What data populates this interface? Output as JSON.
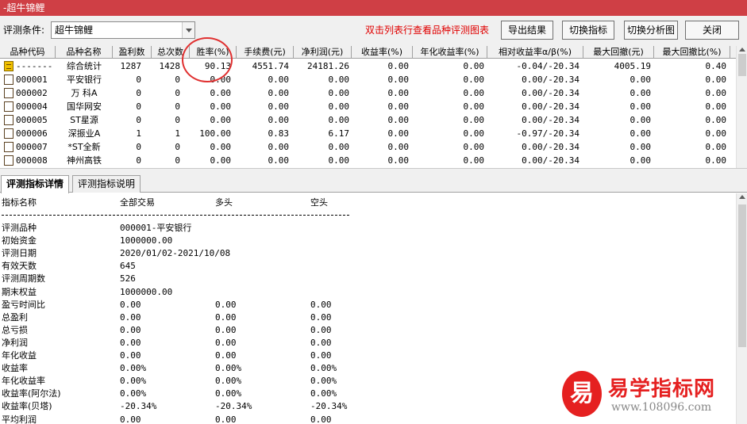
{
  "window": {
    "title": "-超牛锦鲤"
  },
  "toolbar": {
    "condition_label": "评测条件:",
    "condition_value": "超牛锦鲤",
    "hint": "双击列表行查看品种评测图表",
    "export_label": "导出结果",
    "switch_label": "切换指标",
    "chart_label": "切换分析图",
    "close_label": "关闭"
  },
  "grid": {
    "headers": [
      "品种代码",
      "品种名称",
      "盈利数",
      "总次数",
      "胜率(%)",
      "手续费(元)",
      "净利润(元)",
      "收益率(%)",
      "年化收益率(%)",
      "相对收益率α/β(%)",
      "最大回撤(元)",
      "最大回撤比(%)"
    ],
    "rows": [
      {
        "code": "-------",
        "name": "综合统计",
        "win": "1287",
        "total": "1428",
        "rate": "90.13",
        "fee": "4551.74",
        "profit": "24181.26",
        "ret": "0.00",
        "annual": "0.00",
        "rel": "-0.04/-20.34",
        "dd": "4005.19",
        "ddr": "0.40"
      },
      {
        "code": "000001",
        "name": "平安银行",
        "win": "0",
        "total": "0",
        "rate": "0.00",
        "fee": "0.00",
        "profit": "0.00",
        "ret": "0.00",
        "annual": "0.00",
        "rel": "0.00/-20.34",
        "dd": "0.00",
        "ddr": "0.00"
      },
      {
        "code": "000002",
        "name": "万 科A",
        "win": "0",
        "total": "0",
        "rate": "0.00",
        "fee": "0.00",
        "profit": "0.00",
        "ret": "0.00",
        "annual": "0.00",
        "rel": "0.00/-20.34",
        "dd": "0.00",
        "ddr": "0.00"
      },
      {
        "code": "000004",
        "name": "国华网安",
        "win": "0",
        "total": "0",
        "rate": "0.00",
        "fee": "0.00",
        "profit": "0.00",
        "ret": "0.00",
        "annual": "0.00",
        "rel": "0.00/-20.34",
        "dd": "0.00",
        "ddr": "0.00"
      },
      {
        "code": "000005",
        "name": "ST星源",
        "win": "0",
        "total": "0",
        "rate": "0.00",
        "fee": "0.00",
        "profit": "0.00",
        "ret": "0.00",
        "annual": "0.00",
        "rel": "0.00/-20.34",
        "dd": "0.00",
        "ddr": "0.00"
      },
      {
        "code": "000006",
        "name": "深振业A",
        "win": "1",
        "total": "1",
        "rate": "100.00",
        "fee": "0.83",
        "profit": "6.17",
        "ret": "0.00",
        "annual": "0.00",
        "rel": "-0.97/-20.34",
        "dd": "0.00",
        "ddr": "0.00"
      },
      {
        "code": "000007",
        "name": "*ST全新",
        "win": "0",
        "total": "0",
        "rate": "0.00",
        "fee": "0.00",
        "profit": "0.00",
        "ret": "0.00",
        "annual": "0.00",
        "rel": "0.00/-20.34",
        "dd": "0.00",
        "ddr": "0.00"
      },
      {
        "code": "000008",
        "name": "神州高铁",
        "win": "0",
        "total": "0",
        "rate": "0.00",
        "fee": "0.00",
        "profit": "0.00",
        "ret": "0.00",
        "annual": "0.00",
        "rel": "0.00/-20.34",
        "dd": "0.00",
        "ddr": "0.00"
      }
    ]
  },
  "tabs": {
    "detail": "评测指标详情",
    "explain": "评测指标说明"
  },
  "detail": {
    "headers": [
      "指标名称",
      "全部交易",
      "多头",
      "空头"
    ],
    "info": [
      {
        "label": "评测品种",
        "value": "000001-平安银行"
      },
      {
        "label": "初始资金",
        "value": "1000000.00"
      },
      {
        "label": "评测日期",
        "value": "2020/01/02-2021/10/08"
      },
      {
        "label": "有效天数",
        "value": "645"
      },
      {
        "label": "评测周期数",
        "value": "526"
      },
      {
        "label": "期末权益",
        "value": "1000000.00"
      }
    ],
    "metrics": [
      {
        "label": "盈亏时间比",
        "all": "0.00",
        "long": "0.00",
        "short": "0.00"
      },
      {
        "label": "总盈利",
        "all": "0.00",
        "long": "0.00",
        "short": "0.00"
      },
      {
        "label": "总亏损",
        "all": "0.00",
        "long": "0.00",
        "short": "0.00"
      },
      {
        "label": "净利润",
        "all": "0.00",
        "long": "0.00",
        "short": "0.00"
      },
      {
        "label": "年化收益",
        "all": "0.00",
        "long": "0.00",
        "short": "0.00"
      },
      {
        "label": "收益率",
        "all": "0.00%",
        "long": "0.00%",
        "short": "0.00%"
      },
      {
        "label": "年化收益率",
        "all": "0.00%",
        "long": "0.00%",
        "short": "0.00%"
      },
      {
        "label": "收益率(阿尔法)",
        "all": "0.00%",
        "long": "0.00%",
        "short": "0.00%"
      },
      {
        "label": "收益率(贝塔)",
        "all": "-20.34%",
        "long": "-20.34%",
        "short": "-20.34%"
      },
      {
        "label": "平均利润",
        "all": "0.00",
        "long": "0.00",
        "short": "0.00"
      }
    ]
  },
  "watermark": {
    "logo_char": "易",
    "brand": "易学指标网",
    "url": "www.108096.com"
  },
  "colors": {
    "titlebar": "#cf3f45",
    "hint": "#e00000",
    "brand": "#e52020"
  }
}
